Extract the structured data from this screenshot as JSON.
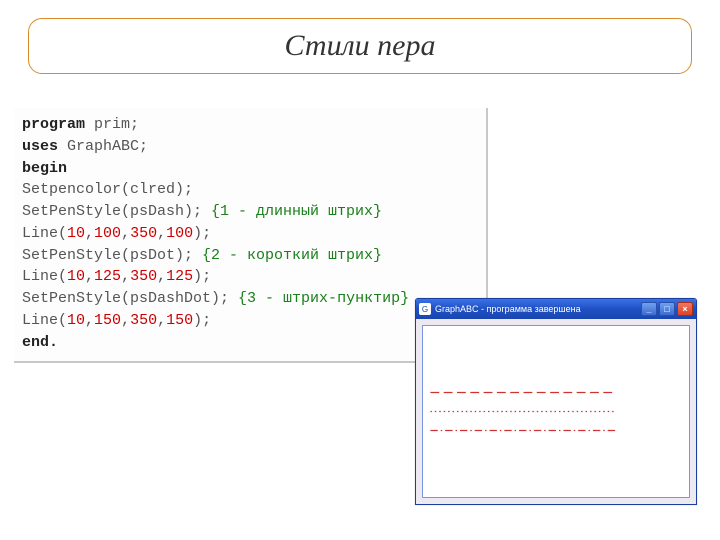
{
  "title": "Стили пера",
  "code": {
    "l1_kw": "program",
    "l1_id": " prim;",
    "l2_kw": "uses",
    "l2_id": " GraphABC;",
    "l3_kw": "begin",
    "l4": "   Setpencolor(clred);",
    "l5a": "   SetPenStyle(psDash);  ",
    "l5c": "{1 - длинный штрих}",
    "l6a": "   Line(",
    "l6n1": "10",
    "l6n2": "100",
    "l6n3": "350",
    "l6n4": "100",
    "l6b": ");",
    "l7a": "   SetPenStyle(psDot);  ",
    "l7c": "{2 - короткий штрих}",
    "l8a": "    Line(",
    "l8n1": "10",
    "l8n2": "125",
    "l8n3": "350",
    "l8n4": "125",
    "l8b": ");",
    "l9a": "    SetPenStyle(psDashDot);  ",
    "l9c": "{3 - штрих-пунктир}",
    "l10a": "    Line(",
    "l10n1": "10",
    "l10n2": "150",
    "l10n3": "350",
    "l10n4": "150",
    "l10b": ");",
    "l11_kw": "end."
  },
  "window": {
    "title": "GraphABC - программа завершена",
    "min": "_",
    "max": "□",
    "close": "×"
  }
}
